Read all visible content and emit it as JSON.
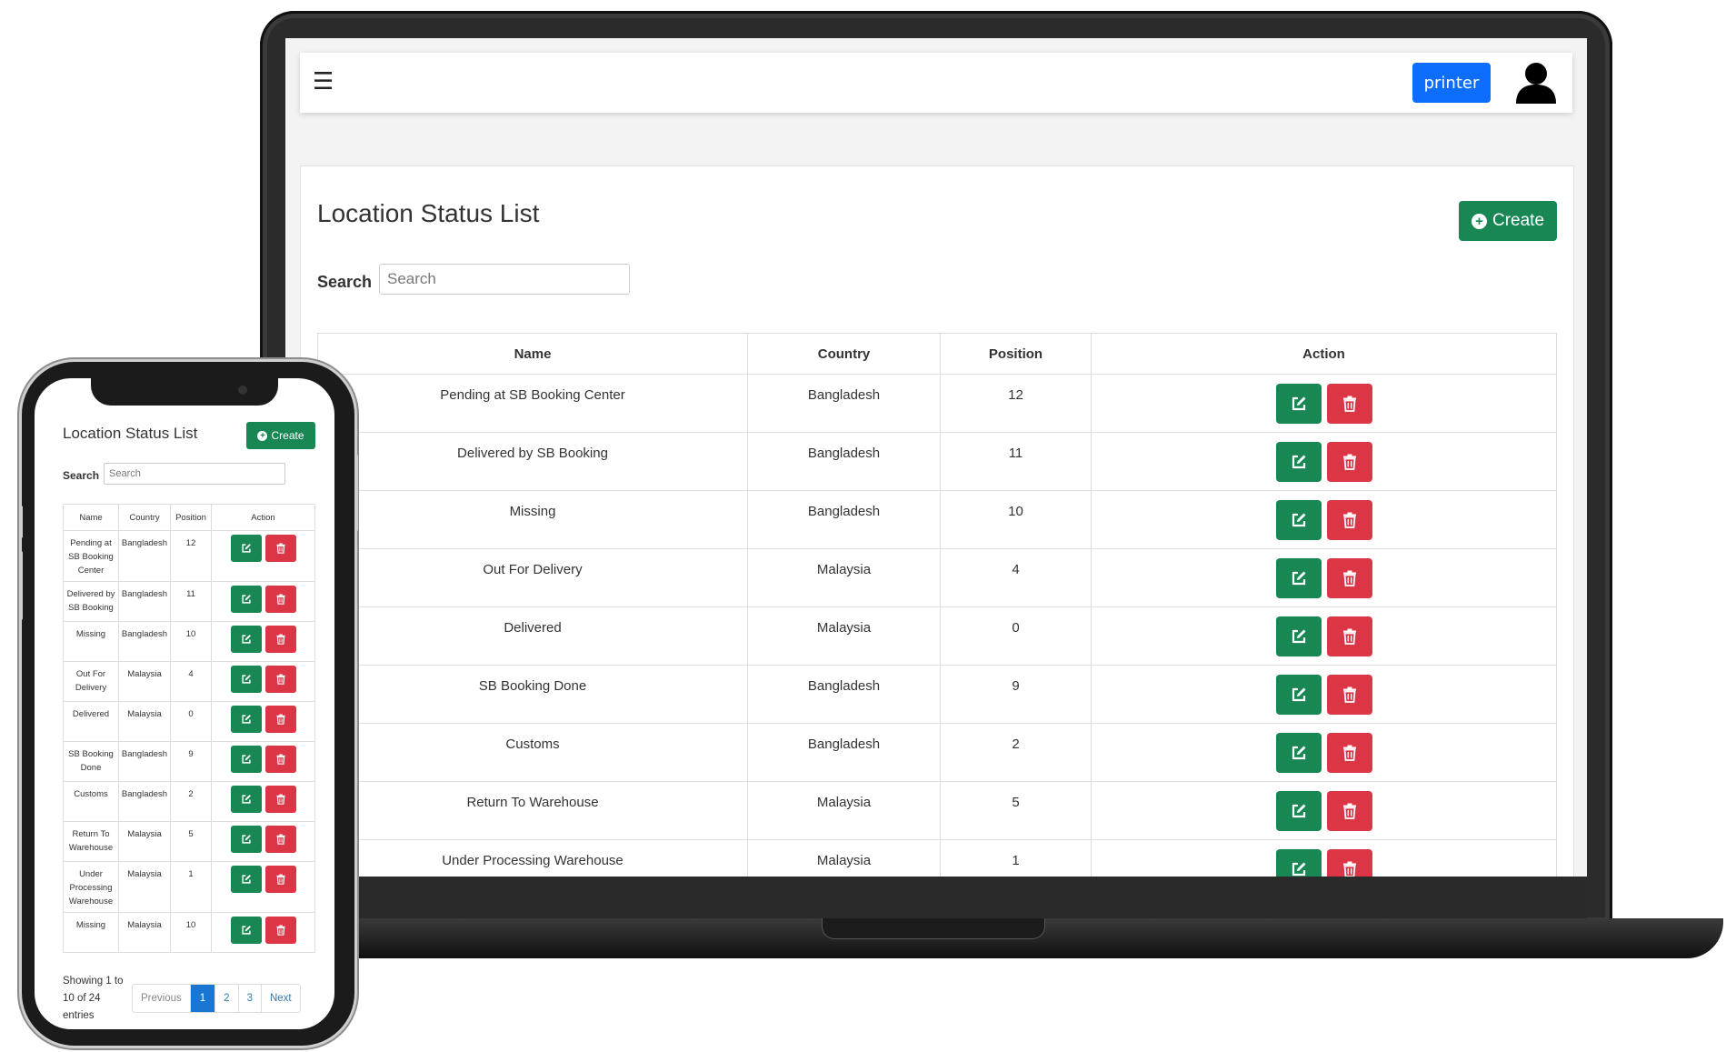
{
  "laptop": {
    "topbar": {
      "menu_icon": "hamburger-icon",
      "printer_label": "printer",
      "avatar_icon": "user-icon"
    },
    "page_title": "Location Status List",
    "create_label": "Create",
    "search_label": "Search",
    "search_placeholder": "Search",
    "columns": [
      "Name",
      "Country",
      "Position",
      "Action"
    ],
    "rows": [
      {
        "name": "Pending at SB Booking Center",
        "country": "Bangladesh",
        "position": "12"
      },
      {
        "name": "Delivered by SB Booking",
        "country": "Bangladesh",
        "position": "11"
      },
      {
        "name": "Missing",
        "country": "Bangladesh",
        "position": "10"
      },
      {
        "name": "Out For Delivery",
        "country": "Malaysia",
        "position": "4"
      },
      {
        "name": "Delivered",
        "country": "Malaysia",
        "position": "0"
      },
      {
        "name": "SB Booking Done",
        "country": "Bangladesh",
        "position": "9"
      },
      {
        "name": "Customs",
        "country": "Bangladesh",
        "position": "2"
      },
      {
        "name": "Return To Warehouse",
        "country": "Malaysia",
        "position": "5"
      },
      {
        "name": "Under Processing Warehouse",
        "country": "Malaysia",
        "position": "1"
      }
    ]
  },
  "phone": {
    "page_title": "Location Status List",
    "create_label": "Create",
    "search_label": "Search",
    "search_placeholder": "Search",
    "columns": [
      "Name",
      "Country",
      "Position",
      "Action"
    ],
    "rows": [
      {
        "name": "Pending at SB Booking Center",
        "country": "Bangladesh",
        "position": "12"
      },
      {
        "name": "Delivered by SB Booking",
        "country": "Bangladesh",
        "position": "11"
      },
      {
        "name": "Missing",
        "country": "Bangladesh",
        "position": "10"
      },
      {
        "name": "Out For Delivery",
        "country": "Malaysia",
        "position": "4"
      },
      {
        "name": "Delivered",
        "country": "Malaysia",
        "position": "0"
      },
      {
        "name": "SB Booking Done",
        "country": "Bangladesh",
        "position": "9"
      },
      {
        "name": "Customs",
        "country": "Bangladesh",
        "position": "2"
      },
      {
        "name": "Return To Warehouse",
        "country": "Malaysia",
        "position": "5"
      },
      {
        "name": "Under Processing Warehouse",
        "country": "Malaysia",
        "position": "1"
      },
      {
        "name": "Missing",
        "country": "Malaysia",
        "position": "10"
      }
    ],
    "info": "Showing 1 to 10 of 24 entries",
    "pagination": {
      "previous": "Previous",
      "pages": [
        "1",
        "2",
        "3"
      ],
      "active_page": "1",
      "next": "Next"
    }
  },
  "colors": {
    "primary": "#0d6efd",
    "success": "#198754",
    "danger": "#dc3545",
    "page_active": "#1976d2"
  },
  "icons": {
    "edit": "edit-icon",
    "delete": "trash-icon",
    "create": "plus-circle-icon"
  }
}
